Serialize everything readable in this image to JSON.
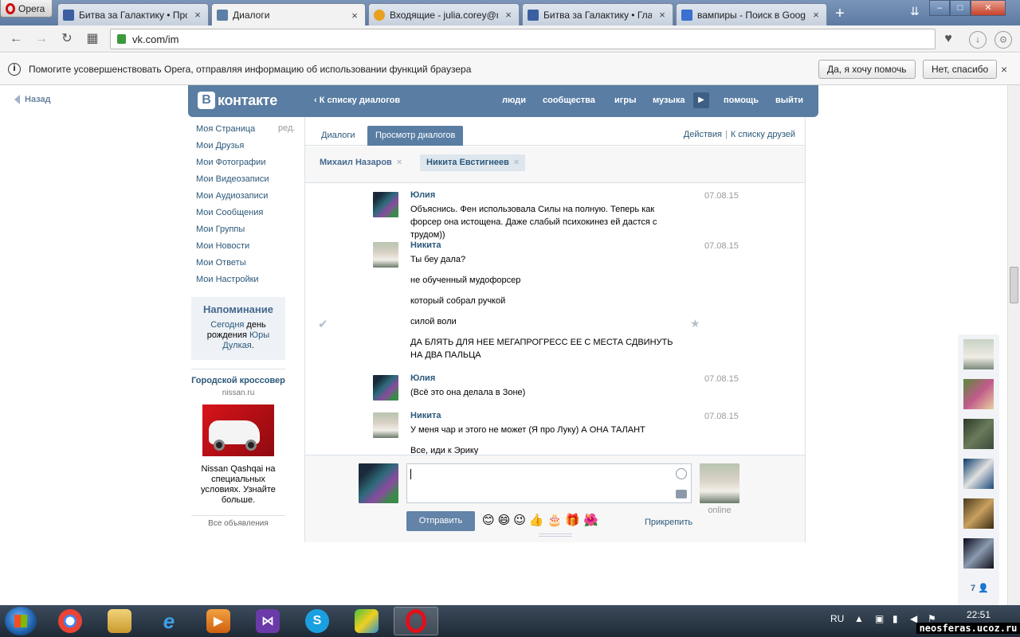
{
  "browser": {
    "menu_label": "Opera",
    "tabs": [
      {
        "title": "Битва за Галактику • Про",
        "icon_color": "#3b5fa0"
      },
      {
        "title": "Диалоги",
        "icon_color": "#5b7fa6"
      },
      {
        "title": "Входящие - julia.corey@m",
        "icon_color": "#e8a020"
      },
      {
        "title": "Битва за Галактику • Глав",
        "icon_color": "#3b5fa0"
      },
      {
        "title": "вампиры - Поиск в Goog",
        "icon_color": "#3b6fd0"
      }
    ],
    "new_tab": "+",
    "url": "vk.com/im",
    "info_text": "Помогите усовершенствовать Opera, отправляя информацию об использовании функций браузера",
    "info_yes": "Да, я хочу помочь",
    "info_no": "Нет, спасибо",
    "info_close": "×"
  },
  "vk": {
    "back": "Назад",
    "logo_box": "В",
    "logo_text": "контакте",
    "header_back": "К списку диалогов",
    "nav": [
      "люди",
      "сообщества",
      "игры",
      "музыка",
      "помощь",
      "выйти"
    ],
    "left_menu": [
      "Моя Страница",
      "Мои Друзья",
      "Мои Фотографии",
      "Мои Видеозаписи",
      "Мои Аудиозаписи",
      "Мои Сообщения",
      "Мои Группы",
      "Мои Новости",
      "Мои Ответы",
      "Мои Настройки"
    ],
    "edit": "ред.",
    "reminder": {
      "title": "Напоминание",
      "today": "Сегодня",
      "t1": " день",
      "t2": "рождения ",
      "name1": "Юры",
      "name2": "Дулкая",
      "dot": "."
    },
    "ad": {
      "title": "Городской кроссовер",
      "domain": "nissan.ru",
      "text": "Nissan Qashqai на специальных условиях. Узнайте больше.",
      "all": "Все объявления"
    },
    "im": {
      "tab_dialogs": "Диалоги",
      "tab_view": "Просмотр диалогов",
      "actions": "Действия",
      "actions_sep": "|",
      "to_friends": "К списку друзей",
      "peers": [
        "Михаил Назаров",
        "Никита Евстигнеев"
      ],
      "peer_x": "×",
      "messages": [
        {
          "author": "Юлия",
          "date": "07.08.15",
          "lines": [
            "Объяснись. Фен использовала Силы на полную. Теперь как форсер она истощена. Даже слабый психокинез ей дастся с трудом))"
          ]
        },
        {
          "author": "Никита",
          "date": "07.08.15",
          "lines": [
            "Ты беу дала?",
            "не обученный мудофорсер",
            "который собрал ручкой",
            "силой воли",
            "ДА БЛЯТЬ ДЛЯ НЕЕ МЕГАПРОГРЕСС ЕЕ С МЕСТА СДВИНУТЬ НА ДВА ПАЛЬЦА"
          ]
        },
        {
          "author": "Юлия",
          "date": "07.08.15",
          "lines": [
            "(Всё это она делала в Зоне)"
          ]
        },
        {
          "author": "Никита",
          "date": "07.08.15",
          "lines": [
            "У меня чар и этого не может (Я про Луку) А ОНА ТАЛАНТ",
            "Все, иди к Эрику"
          ]
        }
      ],
      "check_icon": "✔",
      "star_icon": "★",
      "send_label": "Отправить",
      "attach_label": "Прикрепить",
      "online": "online",
      "emojis": [
        "😊",
        "😄",
        "😉",
        "👍",
        "🎂",
        "🎁",
        "🌺"
      ]
    },
    "friends_count": "7 👤"
  },
  "taskbar": {
    "lang": "RU",
    "time": "22:51",
    "watermark": "neosferas.ucoz.ru"
  },
  "colors": {
    "vk_blue": "#597da3",
    "vk_link": "#2b587a",
    "send_btn": "#6383a8"
  }
}
